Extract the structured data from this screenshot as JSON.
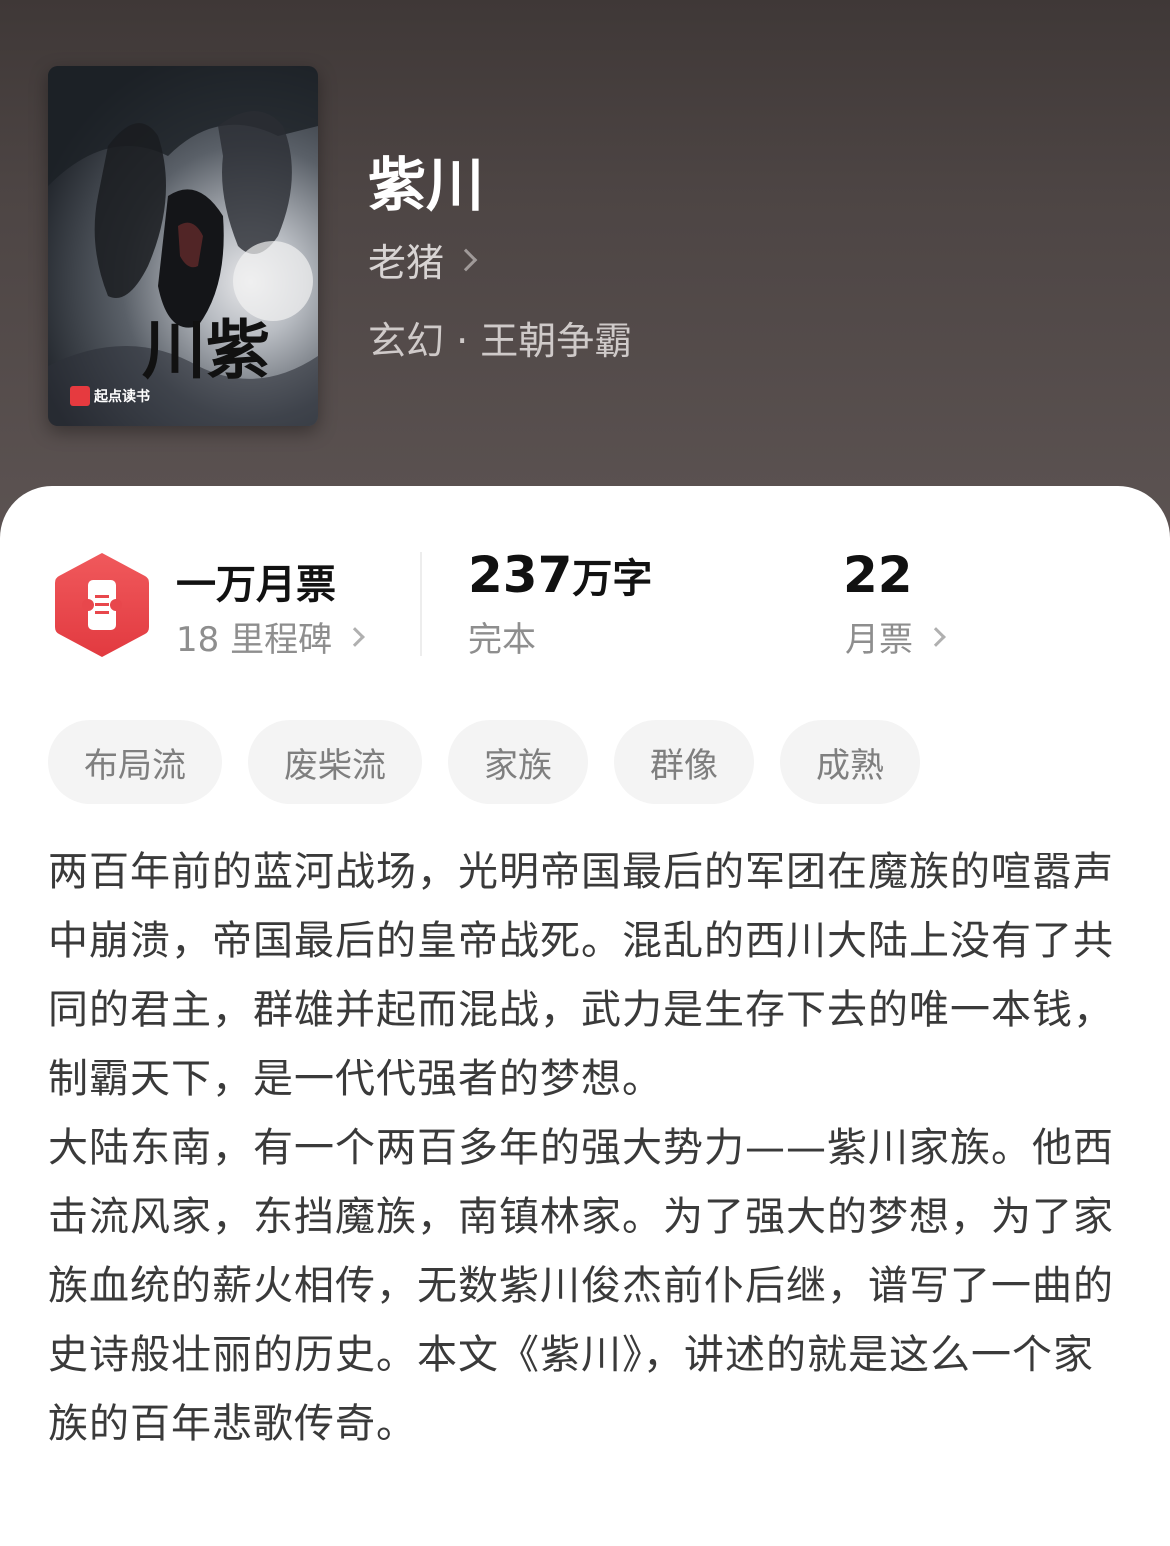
{
  "book": {
    "title": "紫川",
    "author": "老猪",
    "genre": "玄幻 · 王朝争霸",
    "cover": {
      "title_art": "紫川",
      "publisher": "起点读书"
    }
  },
  "stats": {
    "monthly_ticket_tier": "一万月票",
    "milestones": "18 里程碑",
    "word_count_number": "237",
    "word_count_unit": "万字",
    "status": "完本",
    "monthly_tickets": "22",
    "monthly_tickets_label": "月票"
  },
  "tags": [
    "布局流",
    "废柴流",
    "家族",
    "群像",
    "成熟"
  ],
  "description": {
    "paragraph_1": "两百年前的蓝河战场，光明帝国最后的军团在魔族的喧嚣声中崩溃，帝国最后的皇帝战死。混乱的西川大陆上没有了共同的君主，群雄并起而混战，武力是生存下去的唯一本钱，制霸天下，是一代代强者的梦想。",
    "paragraph_2": "大陆东南，有一个两百多年的强大势力——紫川家族。他西击流风家，东挡魔族，南镇林家。为了强大的梦想，为了家族血统的薪火相传，无数紫川俊杰前仆后继，谱写了一曲的史诗般壮丽的历史。本文《紫川》，讲述的就是这么一个家族的百年悲歌传奇。"
  },
  "colors": {
    "accent": "#e8474c",
    "hero_bg": "#4a4241"
  }
}
